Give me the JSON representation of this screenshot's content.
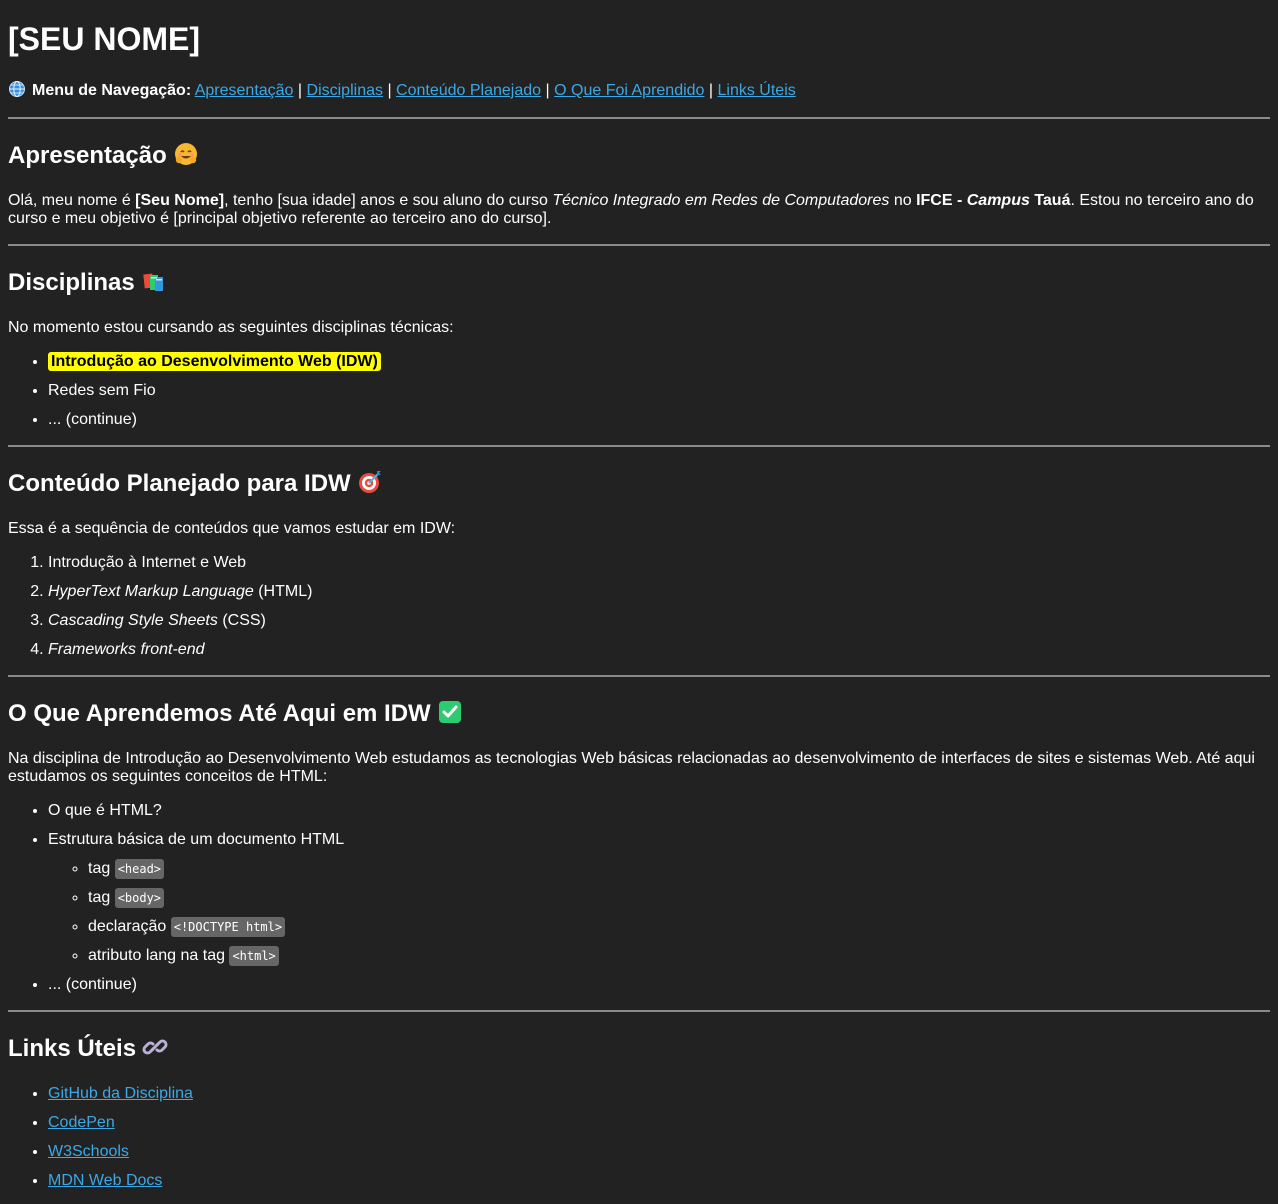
{
  "header": {
    "title": "[SEU NOME]"
  },
  "nav": {
    "label": "Menu de Navegação:",
    "links": [
      {
        "label": "Apresentação"
      },
      {
        "label": "Disciplinas"
      },
      {
        "label": "Conteúdo Planejado"
      },
      {
        "label": "O Que Foi Aprendido"
      },
      {
        "label": "Links Úteis"
      }
    ],
    "separator": "|"
  },
  "apresentacao": {
    "title": "Apresentação",
    "icon": "hugging-face-emoji-icon",
    "text_1": "Olá, meu nome é ",
    "name": "[Seu Nome]",
    "text_2": ", tenho [sua idade] anos e sou aluno do curso ",
    "course": "Técnico Integrado em Redes de Computadores",
    "text_3": " no ",
    "institution": "IFCE - ",
    "campus": "Campus",
    "campus_name": " Tauá",
    "text_4": ". Estou no terceiro ano do curso e meu objetivo é [principal objetivo referente ao terceiro ano do curso]."
  },
  "disciplinas": {
    "title": "Disciplinas",
    "icon": "books-emoji-icon",
    "intro": "No momento estou cursando as seguintes disciplinas técnicas:",
    "items": [
      "Introdução ao Desenvolvimento Web (IDW)",
      "Redes sem Fio",
      "... (continue)"
    ]
  },
  "conteudo": {
    "title": "Conteúdo Planejado para IDW",
    "icon": "target-emoji-icon",
    "intro": "Essa é a sequência de conteúdos que vamos estudar em IDW:",
    "items": [
      {
        "text": "Introdução à Internet e Web",
        "em": "",
        "rest": ""
      },
      {
        "text": "",
        "em": "HyperText Markup Language",
        "rest": " (HTML)"
      },
      {
        "text": "",
        "em": "Cascading Style Sheets",
        "rest": " (CSS)"
      },
      {
        "text": "",
        "em": "Frameworks front-end",
        "rest": ""
      }
    ]
  },
  "aprendido": {
    "title": "O Que Aprendemos Até Aqui em IDW",
    "icon": "check-mark-emoji-icon",
    "intro": "Na disciplina de Introdução ao Desenvolvimento Web estudamos as tecnologias Web básicas relacionadas ao desenvolvimento de interfaces de sites e sistemas Web. Até aqui estudamos os seguintes conceitos de HTML:",
    "items": [
      "O que é HTML?",
      "Estrutura básica de um documento HTML",
      "... (continue)"
    ],
    "subitems": [
      {
        "label": "tag ",
        "code": "<head>"
      },
      {
        "label": "tag ",
        "code": "<body>"
      },
      {
        "label": "declaração ",
        "code": "<!DOCTYPE html>"
      },
      {
        "label": "atributo lang na tag ",
        "code": "<html>"
      }
    ]
  },
  "links": {
    "title": "Links Úteis",
    "icon": "link-emoji-icon",
    "items": [
      "GitHub da Disciplina",
      "CodePen",
      "W3Schools",
      "MDN Web Docs"
    ]
  },
  "colors": {
    "background": "#222222",
    "text": "#ffffff",
    "link": "#3aa9e6",
    "highlight": "#ffff00",
    "code_bg": "#666666",
    "rule": "#8a8a8a"
  }
}
